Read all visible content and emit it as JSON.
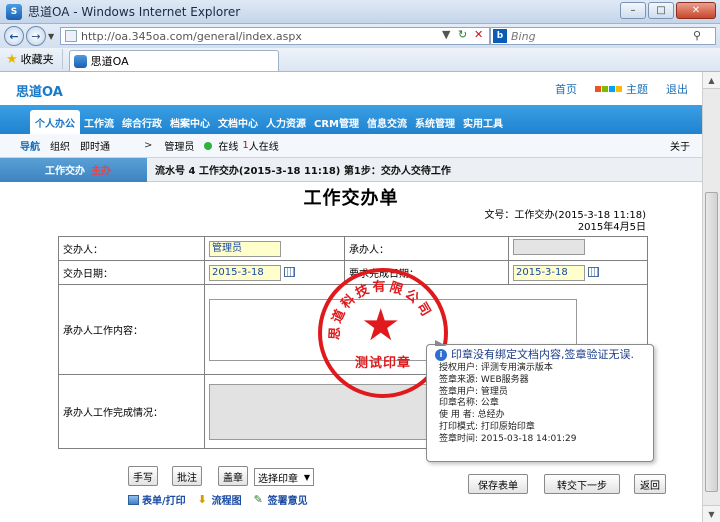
{
  "window": {
    "title": "思道OA - Windows Internet Explorer",
    "icon_label": "S"
  },
  "browser": {
    "url": "http://oa.345oa.com/general/index.aspx",
    "search_placeholder": "Bing",
    "favorites_label": "收藏夹",
    "tab_title": "思道OA"
  },
  "app": {
    "logo": "思道OA",
    "top_links": [
      "首页",
      "主题",
      "退出"
    ],
    "menu": [
      "个人办公",
      "工作流",
      "综合行政",
      "档案中心",
      "文档中心",
      "人力资源",
      "CRM管理",
      "信息交流",
      "系统管理",
      "实用工具"
    ],
    "subnav": {
      "label": "导航",
      "items": [
        "组织",
        "即时通"
      ],
      "separator": ">",
      "user": "管理员",
      "online_prefix": "在线",
      "online_count": "1",
      "online_suffix": "人在线",
      "about": "关于"
    },
    "flow": {
      "tab_label": "工作交办",
      "tab_status": "主办",
      "info": "流水号 4   工作交办(2015-3-18 11:18) 第1步：交办人交待工作"
    }
  },
  "form": {
    "title": "工作交办单",
    "doc_no": "文号：工作交办(2015-3-18 11:18)",
    "doc_date": "2015年4月5日",
    "labels": {
      "assigner": "交办人：",
      "receiver": "承办人：",
      "assign_date": "交办日期：",
      "due_date": "要求完成日期：",
      "content": "承办人工作内容：",
      "completion": "承办人工作完成情况："
    },
    "values": {
      "assigner": "管理员",
      "receiver": "",
      "assign_date": "2015-3-18",
      "due_date": "2015-3-18"
    }
  },
  "stamp": {
    "bottom_text": "测试印章",
    "arc_text": "思道科技有限公司"
  },
  "tooltip": {
    "heading": "印章没有绑定文档内容,签章验证无误.",
    "rows": [
      "授权用户: 评测专用演示版本",
      "签章来源: WEB服务器",
      "签章用户: 管理员",
      "印章名称: 公章",
      "使 用 者: 总经办",
      "打印模式: 打印原始印章",
      "签章时间: 2015-03-18 14:01:29"
    ]
  },
  "actions": {
    "handwrite": "手写",
    "annotate": "批注",
    "seal": "盖章",
    "select_seal": "选择印章",
    "save": "保存表单",
    "next_step": "转交下一步",
    "back": "返回",
    "link_print": "表单/打印",
    "link_flowchart": "流程图",
    "link_opinion": "签署意见"
  },
  "colors": {
    "menu_blue": "#2a8fd9",
    "stamp_red": "#e0191c",
    "link_blue": "#1a6fb8"
  }
}
